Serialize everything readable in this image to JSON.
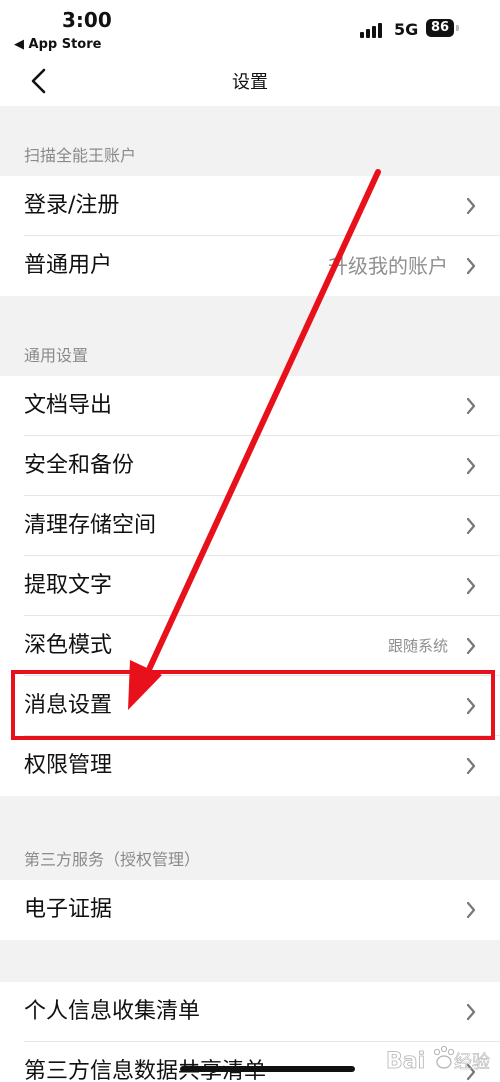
{
  "status_bar": {
    "time": "3:00",
    "back_app": "◀ App Store",
    "network": "5G",
    "battery": "86"
  },
  "nav": {
    "title": "设置",
    "back_icon": "chevron-left-icon"
  },
  "sections": {
    "account": {
      "header": "扫描全能王账户",
      "rows": [
        {
          "label": "登录/注册",
          "value": ""
        },
        {
          "label": "普通用户",
          "value": "升级我的账户"
        }
      ]
    },
    "general": {
      "header": "通用设置",
      "rows": [
        {
          "label": "文档导出",
          "value": ""
        },
        {
          "label": "安全和备份",
          "value": ""
        },
        {
          "label": "清理存储空间",
          "value": ""
        },
        {
          "label": "提取文字",
          "value": ""
        },
        {
          "label": "深色模式",
          "value": "跟随系统"
        },
        {
          "label": "消息设置",
          "value": ""
        },
        {
          "label": "权限管理",
          "value": ""
        }
      ]
    },
    "third_party": {
      "header": "第三方服务（授权管理）",
      "rows": [
        {
          "label": "电子证据",
          "value": ""
        }
      ]
    },
    "privacy": {
      "header": "",
      "rows": [
        {
          "label": "个人信息收集清单",
          "value": ""
        },
        {
          "label": "第三方信息数据共享清单",
          "value": ""
        }
      ]
    }
  },
  "annotation": {
    "color": "#e8101a",
    "target": "消息设置"
  },
  "watermark": {
    "text": "Bai 经验",
    "icon": "baidu-paw-icon"
  }
}
